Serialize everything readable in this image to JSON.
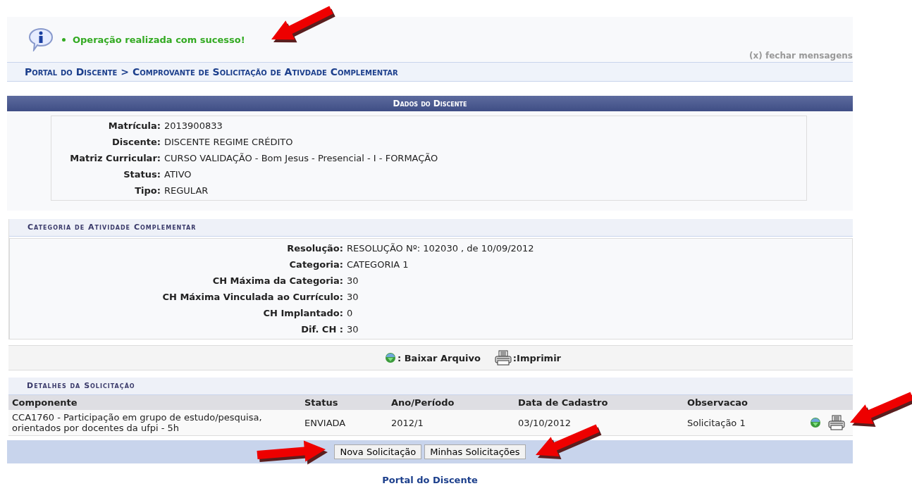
{
  "message": {
    "text": "Operação realizada com sucesso!",
    "close_link": "(x) fechar mensagens"
  },
  "breadcrumb": "Portal do Discente > Comprovante de Solicitação de Ativdade Complementar",
  "student": {
    "title": "Dados do Discente",
    "fields": [
      {
        "label": "Matrícula:",
        "value": "2013900833"
      },
      {
        "label": "Discente:",
        "value": "DISCENTE REGIME CRÉDITO"
      },
      {
        "label": "Matriz Curricular:",
        "value": "CURSO VALIDAÇÃO - Bom Jesus - Presencial - I - FORMAÇÃO"
      },
      {
        "label": "Status:",
        "value": "ATIVO"
      },
      {
        "label": "Tipo:",
        "value": "REGULAR"
      }
    ]
  },
  "category": {
    "title": "Categoria de Atividade Complementar",
    "fields": [
      {
        "label": "Resolução:",
        "value": "RESOLUÇÃO Nº: 102030 , de 10/09/2012"
      },
      {
        "label": "Categoria:",
        "value": "CATEGORIA 1"
      },
      {
        "label": "CH Máxima da Categoria:",
        "value": "30"
      },
      {
        "label": "CH Máxima Vinculada ao Currículo:",
        "value": "30"
      },
      {
        "label": "CH Implantado:",
        "value": "0"
      },
      {
        "label": "Dif. CH :",
        "value": "30"
      }
    ]
  },
  "legend": [
    {
      "kind": "download",
      "label": ": Baixar Arquivo"
    },
    {
      "kind": "print",
      "label": ":Imprimir"
    }
  ],
  "details": {
    "title": "Detalhes da Solicitação",
    "columns": [
      "Componente",
      "Status",
      "Ano/Período",
      "Data de Cadastro",
      "Observacao"
    ],
    "rows": [
      {
        "cells": [
          "CCA1760 - Participação em grupo de estudo/pesquisa, orientados por docentes da ufpi - 5h",
          "ENVIADA",
          "2012/1",
          "03/10/2012",
          "Solicitação 1"
        ],
        "actions": [
          {
            "kind": "download"
          },
          {
            "kind": "print"
          }
        ]
      }
    ]
  },
  "buttons": [
    "Nova Solicitação",
    "Minhas Solicitações"
  ],
  "footer_link": "Portal do Discente"
}
